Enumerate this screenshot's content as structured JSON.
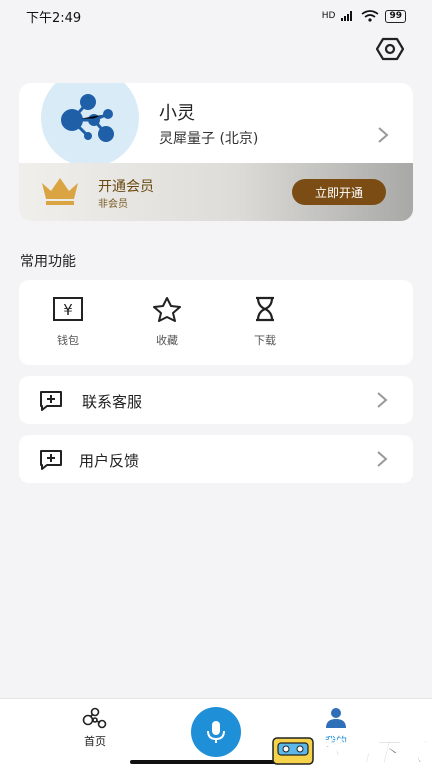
{
  "status_bar": {
    "time": "下午2:49",
    "signal": "HD",
    "battery": "99"
  },
  "profile": {
    "name": "小灵",
    "company": "灵犀量子 (北京)"
  },
  "vip": {
    "title": "开通会员",
    "subtitle": "非会员",
    "button": "立即开通"
  },
  "common_functions": {
    "title": "常用功能",
    "items": [
      {
        "label": "钱包",
        "icon": "wallet-icon"
      },
      {
        "label": "收藏",
        "icon": "star-icon"
      },
      {
        "label": "下载",
        "icon": "hourglass-icon"
      }
    ]
  },
  "list_items": [
    {
      "label": "联系客服",
      "icon": "chat-plus-icon"
    },
    {
      "label": "用户反馈",
      "icon": "chat-plus-icon"
    }
  ],
  "bottom_nav": {
    "home_label": "首页",
    "mine_label": "我的"
  },
  "watermark": {
    "text": "的后下载"
  },
  "colors": {
    "accent": "#1f8fd8",
    "vip_button": "#7b4d14",
    "crown": "#d9a441"
  }
}
